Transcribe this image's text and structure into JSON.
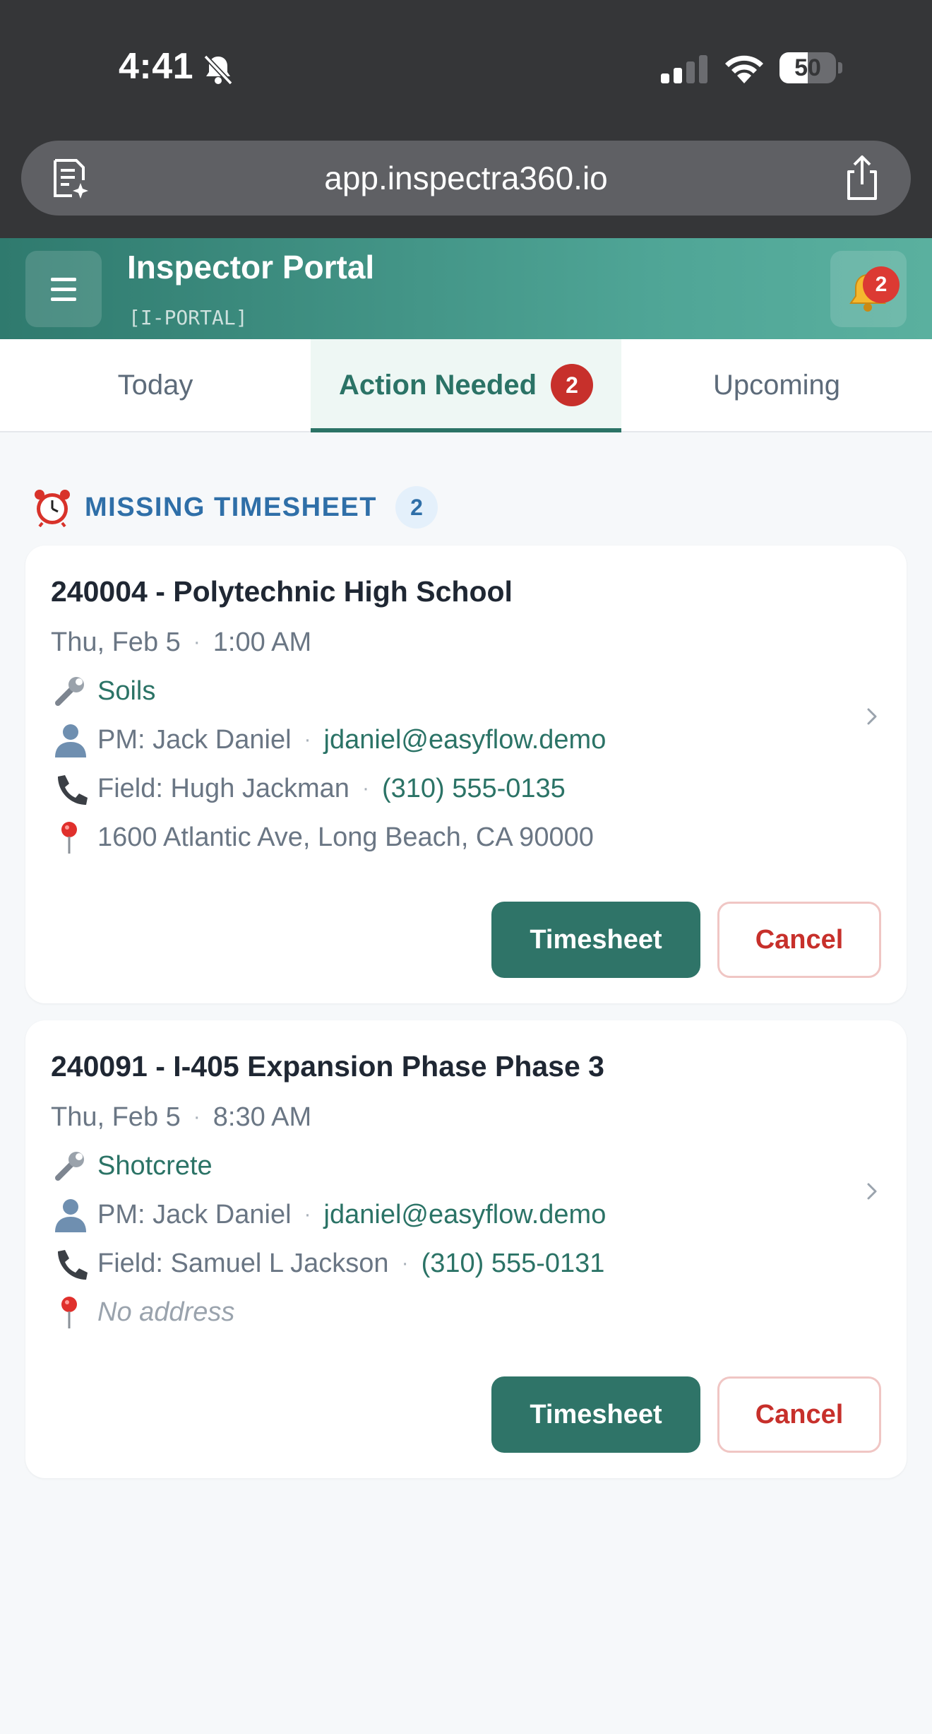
{
  "status_bar": {
    "time": "4:41",
    "battery_level": "50",
    "battery_fraction": 0.5,
    "icons": [
      "bell-slash-icon",
      "cellular-signal-icon",
      "wifi-icon",
      "battery-icon"
    ]
  },
  "browser": {
    "url": "app.inspectra360.io",
    "icons": [
      "reader-icon",
      "share-icon"
    ]
  },
  "header": {
    "title": "Inspector Portal",
    "code": "[I-PORTAL]",
    "notification_count": "2"
  },
  "tabs": [
    {
      "label": "Today",
      "active": false
    },
    {
      "label": "Action Needed",
      "active": true,
      "badge": "2"
    },
    {
      "label": "Upcoming",
      "active": false
    }
  ],
  "section": {
    "title": "MISSING TIMESHEET",
    "count": "2"
  },
  "cards": [
    {
      "title": "240004 - Polytechnic High School",
      "date": "Thu, Feb 5",
      "time": "1:00 AM",
      "service": "Soils",
      "pm": "PM: Jack Daniel",
      "pm_email": "jdaniel@easyflow.demo",
      "field": "Field: Hugh Jackman",
      "field_phone": "(310) 555-0135",
      "address": "1600 Atlantic Ave, Long Beach, CA 90000",
      "timesheet_label": "Timesheet",
      "cancel_label": "Cancel"
    },
    {
      "title": "240091 - I-405 Expansion Phase Phase 3",
      "date": "Thu, Feb 5",
      "time": "8:30 AM",
      "service": "Shotcrete",
      "pm": "PM: Jack Daniel",
      "pm_email": "jdaniel@easyflow.demo",
      "field": "Field: Samuel L Jackson",
      "field_phone": "(310) 555-0131",
      "address": "No address",
      "timesheet_label": "Timesheet",
      "cancel_label": "Cancel"
    }
  ],
  "colors": {
    "brand": "#2f7a6e",
    "accent_link": "#2b7366",
    "danger": "#c7302b",
    "section_blue": "#2f6fa8"
  }
}
